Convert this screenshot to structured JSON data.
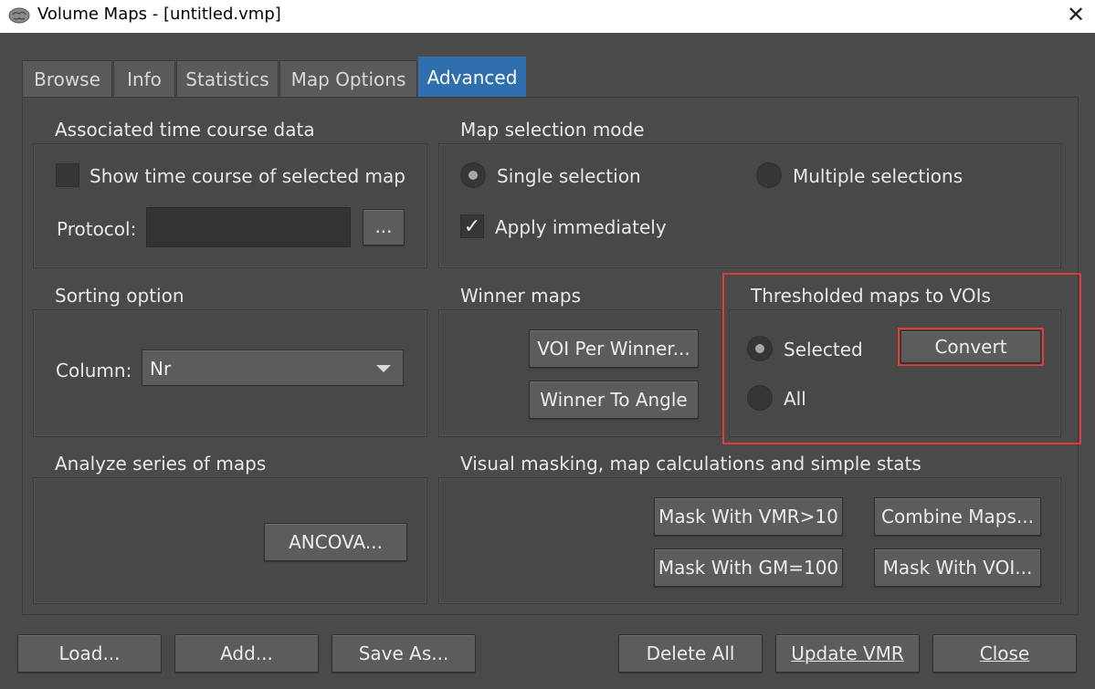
{
  "window": {
    "title": "Volume Maps - [untitled.vmp]",
    "close_glyph": "✕",
    "icon": "brain-icon"
  },
  "tabs": [
    {
      "label": "Browse"
    },
    {
      "label": "Info"
    },
    {
      "label": "Statistics"
    },
    {
      "label": "Map Options"
    },
    {
      "label": "Advanced",
      "active": true
    }
  ],
  "time_course": {
    "title": "Associated time course data",
    "show_label": "Show time course of selected map",
    "show_checked": false,
    "protocol_label": "Protocol:",
    "protocol_value": "",
    "browse_label": "..."
  },
  "map_selection": {
    "title": "Map selection mode",
    "single_label": "Single selection",
    "single_selected": true,
    "multiple_label": "Multiple selections",
    "multiple_selected": false,
    "apply_label": "Apply immediately",
    "apply_checked": true,
    "check_glyph": "✓"
  },
  "sorting": {
    "title": "Sorting option",
    "column_label": "Column:",
    "column_value": "Nr"
  },
  "winner_maps": {
    "title": "Winner maps",
    "voi_per_winner_label": "VOI Per Winner...",
    "winner_to_angle_label": "Winner To Angle"
  },
  "thresholded": {
    "title": "Thresholded maps to VOIs",
    "selected_label": "Selected",
    "selected_checked": true,
    "all_label": "All",
    "all_checked": false,
    "convert_label": "Convert",
    "highlight_color": "#e03a3a"
  },
  "series": {
    "title": "Analyze series of maps",
    "ancova_label": "ANCOVA..."
  },
  "masking": {
    "title": "Visual masking,  map calculations and simple stats",
    "mask_vmr_label": "Mask With VMR>10",
    "combine_label": "Combine Maps...",
    "mask_gm_label": "Mask With GM=100",
    "mask_voi_label": "Mask With VOI..."
  },
  "footer": {
    "load_label": "Load...",
    "add_label": "Add...",
    "save_as_label": "Save As...",
    "delete_all_label": "Delete All",
    "update_vmr_label": "Update VMR",
    "close_label": "Close"
  },
  "colors": {
    "background": "#4a4a4a",
    "accent_tab": "#2f6fad",
    "highlight": "#e03a3a"
  }
}
